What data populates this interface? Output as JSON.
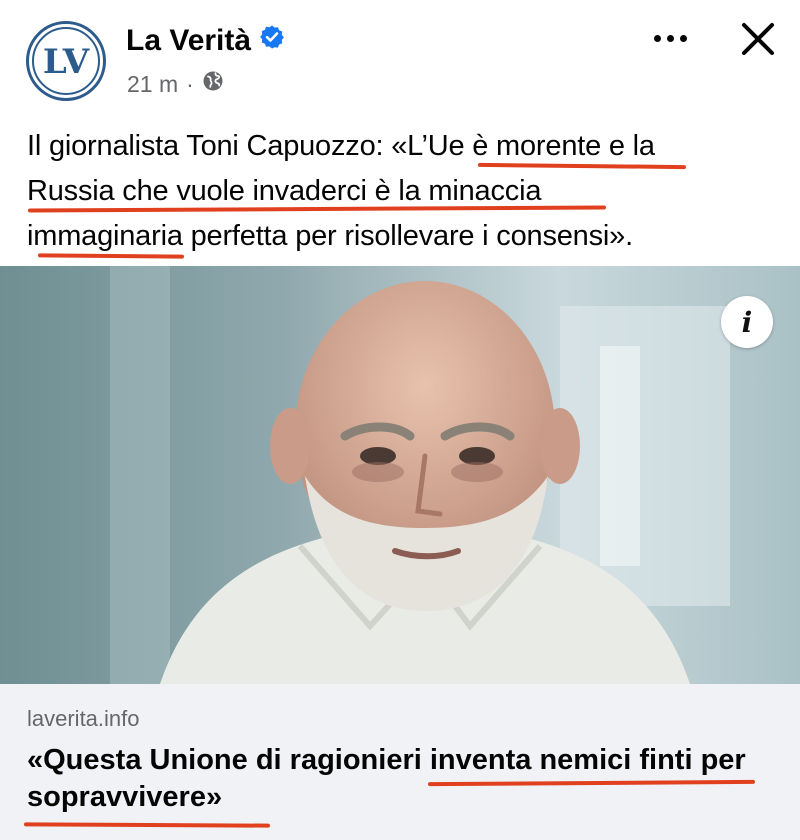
{
  "post": {
    "page_name": "La Verità",
    "timestamp": "21 m",
    "separator": "·",
    "avatar_text": "LV",
    "verified": true,
    "caption_lines": [
      "Il giornalista Toni Capuozzo: «L’Ue è morente e la",
      "Russia che vuole invaderci è la minaccia",
      "immaginaria perfetta per risollevare i consensi»."
    ]
  },
  "link_preview": {
    "domain": "laverita.info",
    "title_lines": [
      "«Questa Unione di ragionieri inventa nemici finti per",
      "sopravvivere»"
    ]
  },
  "icons": {
    "verified": "verified-badge-icon",
    "audience": "globe-icon",
    "more": "more-options-icon",
    "close": "close-icon",
    "info": "info-icon"
  },
  "colors": {
    "underline_marks": "#e0401e",
    "verified_badge": "#1877f2",
    "logo_blue": "#2d5b8c",
    "secondary_text": "#65676b",
    "link_card_bg": "#f0f2f5"
  }
}
